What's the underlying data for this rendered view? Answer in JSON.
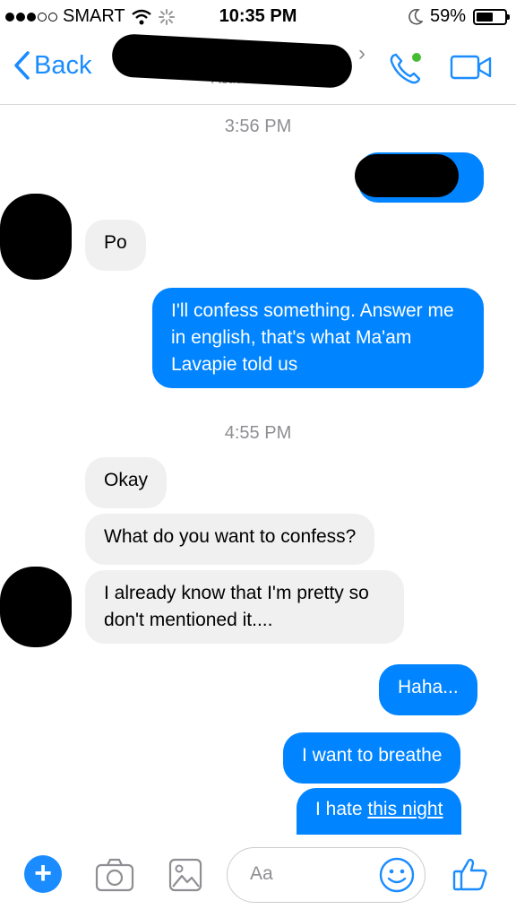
{
  "status": {
    "carrier": "SMART",
    "time": "10:35 PM",
    "battery": "59%",
    "battery_level": 0.59
  },
  "nav": {
    "back_label": "Back",
    "subtitle": "Active now"
  },
  "messages": {
    "ts1": "3:56 PM",
    "m_po": "Po",
    "m_confess": "I'll confess something. Answer me in english, that's what Ma'am Lavapie told us",
    "ts2": "4:55 PM",
    "m_okay": "Okay",
    "m_what": "What do you want to confess?",
    "m_already": "I already know that I'm pretty so don't mentioned it....",
    "m_haha": "Haha...",
    "m_breathe": "I want to breathe",
    "m_hate_prefix": "I hate ",
    "m_hate_link": "this night"
  },
  "composer": {
    "placeholder": "Aa"
  },
  "colors": {
    "accent": "#0084ff",
    "incoming": "#f1f0f0",
    "meta": "#8e8e93",
    "online": "#44bd32"
  },
  "icons": [
    "wifi-icon",
    "loading-icon",
    "moon-icon",
    "battery-icon",
    "back-chevron-icon",
    "chevron-right-icon",
    "phone-icon",
    "video-icon",
    "plus-icon",
    "camera-icon",
    "gallery-icon",
    "emoji-icon",
    "like-icon"
  ]
}
